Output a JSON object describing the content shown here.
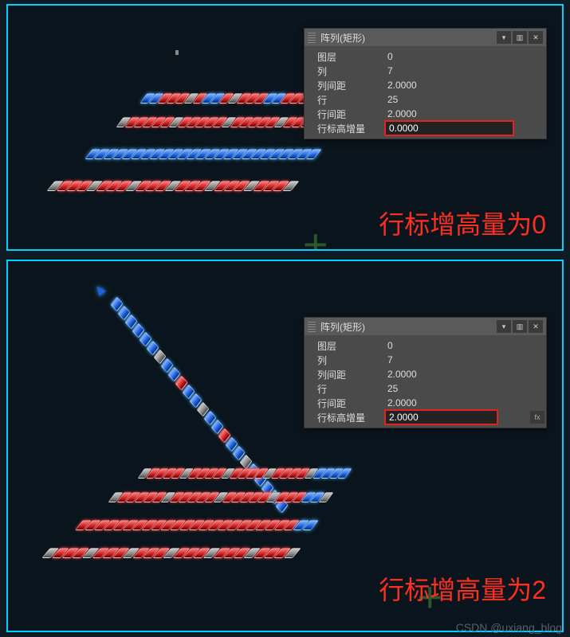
{
  "panel1": {
    "title": "阵列(矩形)",
    "rows": [
      {
        "k": "图层",
        "v": "0"
      },
      {
        "k": "列",
        "v": "7"
      },
      {
        "k": "列间距",
        "v": "2.0000"
      },
      {
        "k": "行",
        "v": "25"
      },
      {
        "k": "行间距",
        "v": "2.0000"
      },
      {
        "k": "行标高增量",
        "v": "0.0000"
      }
    ]
  },
  "panel2": {
    "title": "阵列(矩形)",
    "rows": [
      {
        "k": "图层",
        "v": "0"
      },
      {
        "k": "列",
        "v": "7"
      },
      {
        "k": "列间距",
        "v": "2.0000"
      },
      {
        "k": "行",
        "v": "25"
      },
      {
        "k": "行间距",
        "v": "2.0000"
      },
      {
        "k": "行标高增量",
        "v": "2.0000"
      }
    ]
  },
  "caption1": "行标增高量为0",
  "caption2": "行标增高量为2",
  "watermark": "CSDN @uxiang_blog",
  "icons": {
    "dropdown": "▾",
    "ui": "▥",
    "close": "✕",
    "fx": "fx"
  }
}
